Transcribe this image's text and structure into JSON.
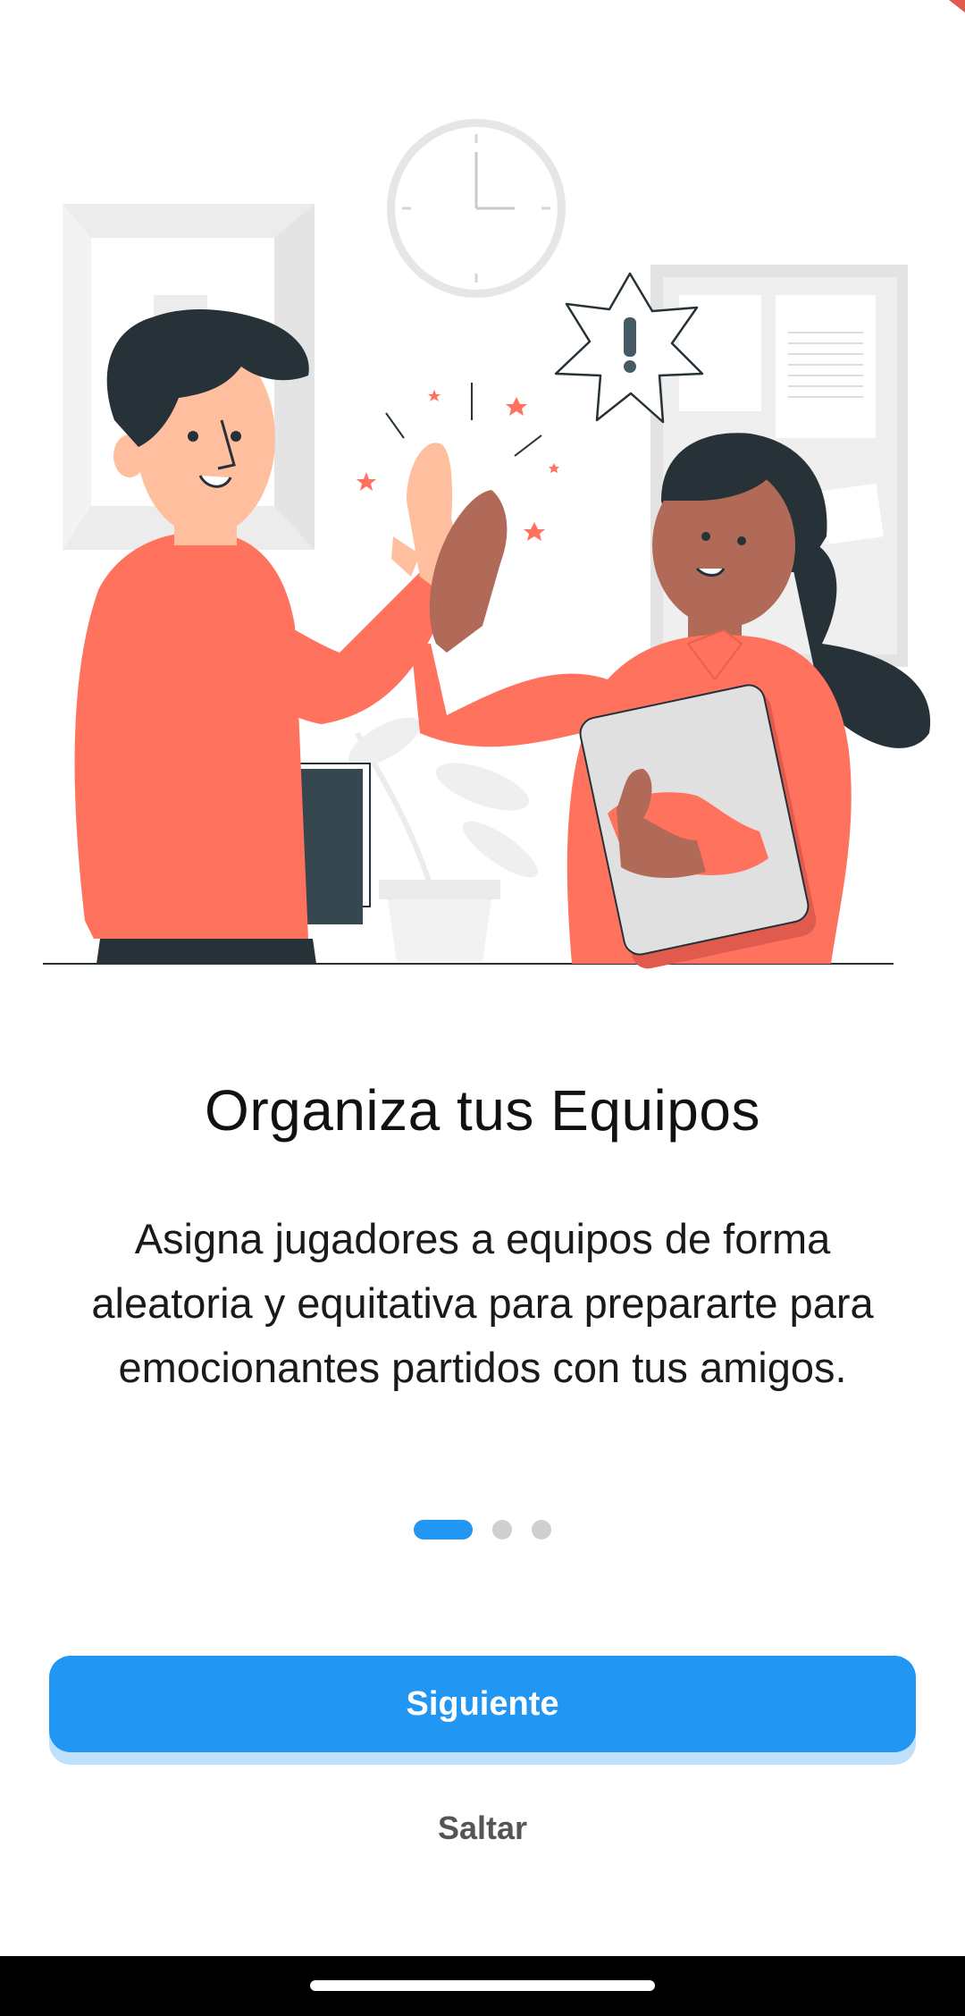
{
  "onboarding": {
    "title": "Organiza tus Equipos",
    "description": "Asigna jugadores a equipos de forma aleatoria y equitativa para prepararte para emocionantes partidos con tus amigos.",
    "illustration": "high-five-illustration",
    "pager": {
      "total": 3,
      "active_index": 0
    }
  },
  "buttons": {
    "next_label": "Siguiente",
    "skip_label": "Saltar"
  },
  "colors": {
    "accent": "#2196F3",
    "illustration_primary": "#FF725E",
    "dark": "#263238"
  }
}
